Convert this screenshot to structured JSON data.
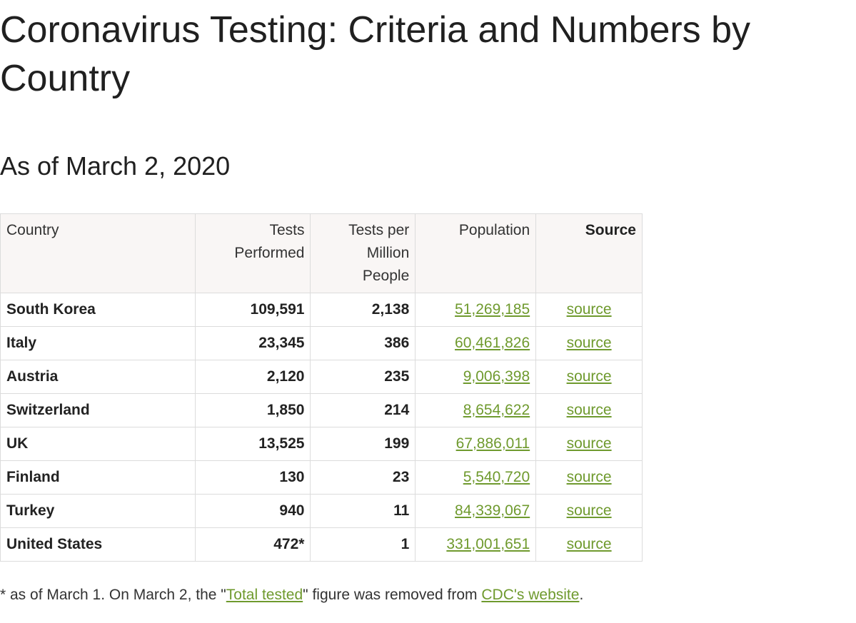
{
  "title": "Coronavirus Testing: Criteria and Numbers by Country",
  "subtitle": "As of March 2, 2020",
  "table": {
    "headers": [
      "Country",
      "Tests Performed",
      "Tests per Million People",
      "Population",
      "Source"
    ],
    "rows": [
      {
        "country": "South Korea",
        "tests": "109,591",
        "per_million": "2,138",
        "population": "51,269,185",
        "source": "source"
      },
      {
        "country": "Italy",
        "tests": "23,345",
        "per_million": "386",
        "population": "60,461,826",
        "source": "source"
      },
      {
        "country": "Austria",
        "tests": "2,120",
        "per_million": "235",
        "population": "9,006,398",
        "source": "source"
      },
      {
        "country": "Switzerland",
        "tests": "1,850",
        "per_million": "214",
        "population": "8,654,622",
        "source": "source"
      },
      {
        "country": "UK",
        "tests": "13,525",
        "per_million": "199",
        "population": "67,886,011",
        "source": "source"
      },
      {
        "country": "Finland",
        "tests": "130",
        "per_million": "23",
        "population": "5,540,720",
        "source": "source"
      },
      {
        "country": "Turkey",
        "tests": "940",
        "per_million": "11",
        "population": "84,339,067",
        "source": "source"
      },
      {
        "country": "United States",
        "tests": "472*",
        "per_million": "1",
        "population": "331,001,651",
        "source": "source"
      }
    ]
  },
  "footnote": {
    "prefix": "* as of March 1. On March 2, the \"",
    "link1": "Total tested",
    "middle": "\" figure was removed from ",
    "link2": "CDC's website",
    "suffix": "."
  },
  "colors": {
    "link": "#6f9a2e",
    "header_bg": "#f9f6f5",
    "border": "#dcdcdc"
  }
}
